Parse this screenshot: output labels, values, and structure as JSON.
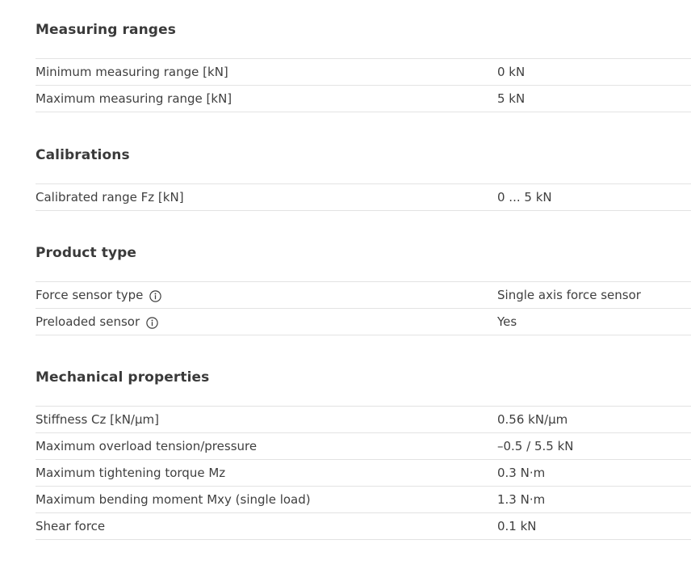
{
  "sections": [
    {
      "title": "Measuring ranges",
      "rows": [
        {
          "label": "Minimum measuring range [kN]",
          "value": "0 kN"
        },
        {
          "label": "Maximum measuring range [kN]",
          "value": "5 kN"
        }
      ]
    },
    {
      "title": "Calibrations",
      "rows": [
        {
          "label": "Calibrated range Fz [kN]",
          "value": "0 ... 5 kN"
        }
      ]
    },
    {
      "title": "Product type",
      "rows": [
        {
          "label": "Force sensor type",
          "value": "Single axis force sensor",
          "icon": "info-icon"
        },
        {
          "label": "Preloaded sensor",
          "value": "Yes",
          "icon": "info-icon"
        }
      ]
    },
    {
      "title": "Mechanical properties",
      "rows": [
        {
          "label": "Stiffness Cz [kN/µm]",
          "value": "0.56 kN/µm"
        },
        {
          "label": "Maximum overload tension/pressure",
          "value": "–0.5 / 5.5 kN"
        },
        {
          "label": "Maximum tightening torque Mz",
          "value": "0.3 N·m"
        },
        {
          "label": "Maximum bending moment Mxy (single load)",
          "value": "1.3 N·m"
        },
        {
          "label": "Shear force",
          "value": "0.1 kN"
        }
      ]
    }
  ]
}
